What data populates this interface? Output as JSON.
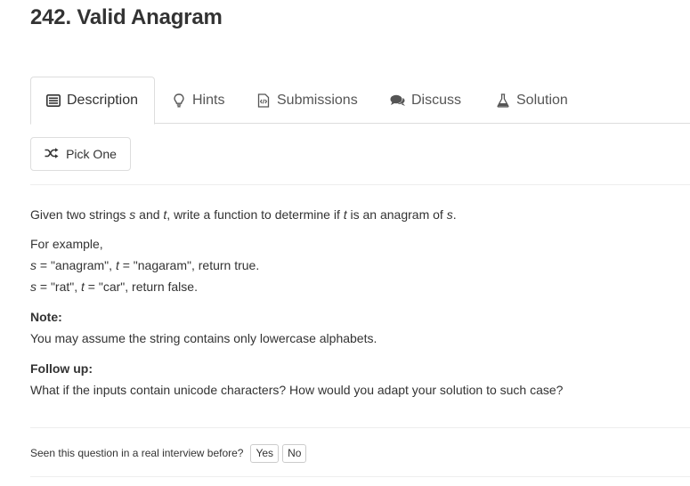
{
  "problem": {
    "title": "242. Valid Anagram"
  },
  "tabs": [
    {
      "label": "Description",
      "icon": "description-icon",
      "active": true
    },
    {
      "label": "Hints",
      "icon": "lightbulb-icon"
    },
    {
      "label": "Submissions",
      "icon": "code-file-icon"
    },
    {
      "label": "Discuss",
      "icon": "comments-icon"
    },
    {
      "label": "Solution",
      "icon": "flask-icon"
    }
  ],
  "pick_one": {
    "label": "Pick One",
    "icon": "shuffle-icon"
  },
  "description": {
    "intro": {
      "p1": "Given two strings ",
      "s": "s",
      "p2": " and ",
      "t": "t",
      "p3": ", write a function to determine if ",
      "t2": "t",
      "p4": " is an anagram of ",
      "s2": "s",
      "p5": "."
    },
    "example_heading": "For example,",
    "example1": {
      "s": "s",
      "a": " = \"anagram\", ",
      "t": "t",
      "b": " = \"nagaram\", return true."
    },
    "example2": {
      "s": "s",
      "a": " = \"rat\", ",
      "t": "t",
      "b": " = \"car\", return false."
    },
    "note_heading": "Note:",
    "note_text": "You may assume the string contains only lowercase alphabets.",
    "followup_heading": "Follow up:",
    "followup_text": "What if the inputs contain unicode characters? How would you adapt your solution to such case?"
  },
  "interview": {
    "question": "Seen this question in a real interview before?",
    "yes": "Yes",
    "no": "No"
  }
}
